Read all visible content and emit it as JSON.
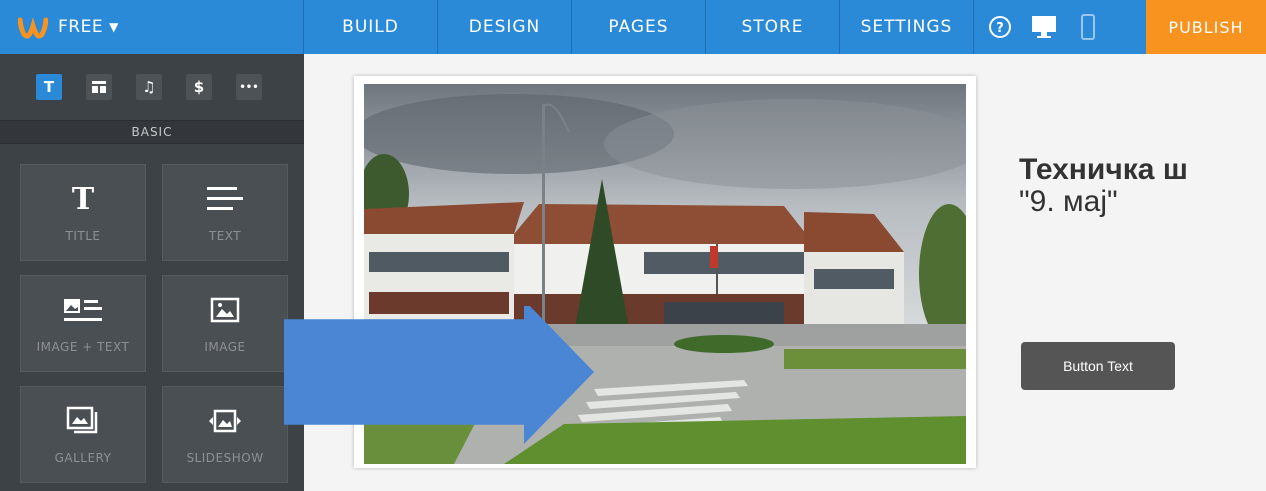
{
  "topbar": {
    "plan": "FREE",
    "nav": [
      "BUILD",
      "DESIGN",
      "PAGES",
      "STORE",
      "SETTINGS"
    ],
    "icons": [
      "help-icon",
      "desktop-icon",
      "mobile-icon"
    ],
    "publish": "PUBLISH"
  },
  "sidebar": {
    "categories": [
      {
        "glyph": "T",
        "icon": "text-category-icon",
        "active": true
      },
      {
        "glyph": "▀",
        "icon": "layout-category-icon",
        "active": false
      },
      {
        "glyph": "♫",
        "icon": "media-category-icon",
        "active": false
      },
      {
        "glyph": "$",
        "icon": "commerce-category-icon",
        "active": false
      },
      {
        "glyph": "•••",
        "icon": "more-category-icon",
        "active": false
      }
    ],
    "section": "BASIC",
    "elements": [
      {
        "label": "TITLE",
        "icon": "title-icon"
      },
      {
        "label": "TEXT",
        "icon": "text-icon"
      },
      {
        "label": "IMAGE + TEXT",
        "icon": "image-text-icon"
      },
      {
        "label": "IMAGE",
        "icon": "image-icon"
      },
      {
        "label": "GALLERY",
        "icon": "gallery-icon"
      },
      {
        "label": "SLIDESHOW",
        "icon": "slideshow-icon"
      }
    ]
  },
  "canvas": {
    "heading_line1": "Техничка ш",
    "heading_line2": "\"9. мај\"",
    "button": "Button Text"
  },
  "colors": {
    "topbar": "#2b8ad8",
    "publish": "#f7931e",
    "sidebar": "#3d4247",
    "arrow": "#4a86d4"
  }
}
